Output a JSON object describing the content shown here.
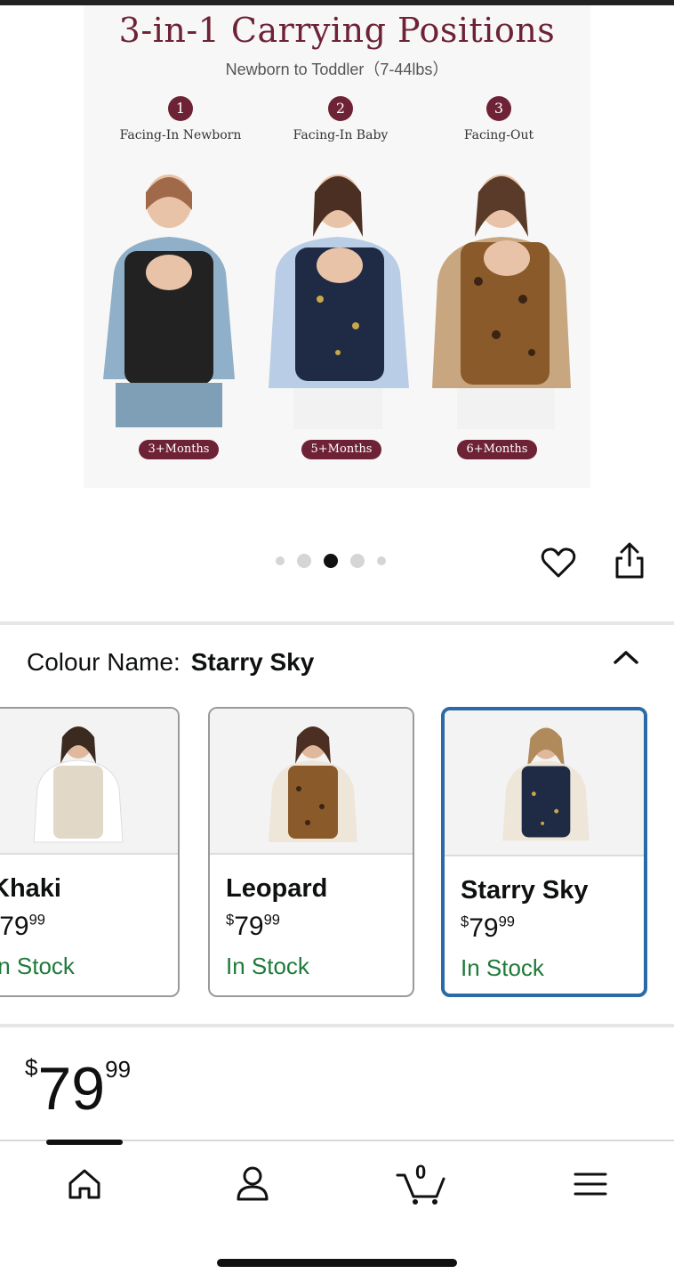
{
  "hero": {
    "title": "3-in-1 Carrying Positions",
    "subtitle": "Newborn to Toddler（7-44lbs）",
    "positions": [
      {
        "num": "1",
        "label": "Facing-In Newborn",
        "badge": "3+Months",
        "carrier_color": "#222222"
      },
      {
        "num": "2",
        "label": "Facing-In Baby",
        "badge": "5+Months",
        "carrier_color": "#1f2a44"
      },
      {
        "num": "3",
        "label": "Facing-Out",
        "badge": "6+Months",
        "carrier_color": "#8a5a2b"
      }
    ],
    "accent_color": "#6e2236"
  },
  "carousel": {
    "dot_count": 5,
    "active_index": 2
  },
  "actions": {
    "favorite_icon": "heart-icon",
    "share_icon": "share-icon"
  },
  "colour": {
    "label": "Colour Name:",
    "value": "Starry Sky",
    "toggle_icon": "chevron-up-icon"
  },
  "swatches": [
    {
      "name": "Khaki",
      "price_symbol": "$",
      "price_whole": "79",
      "price_fraction": "99",
      "stock": "In Stock",
      "carrier_color": "#e2d8c8",
      "selected": false
    },
    {
      "name": "Leopard",
      "price_symbol": "$",
      "price_whole": "79",
      "price_fraction": "99",
      "stock": "In Stock",
      "carrier_color": "#8a5a2b",
      "selected": false
    },
    {
      "name": "Starry Sky",
      "price_symbol": "$",
      "price_whole": "79",
      "price_fraction": "99",
      "stock": "In Stock",
      "carrier_color": "#1f2a44",
      "selected": true
    }
  ],
  "price": {
    "symbol": "$",
    "whole": "79",
    "fraction": "99"
  },
  "bottom_nav": {
    "items": [
      {
        "name": "home-icon"
      },
      {
        "name": "account-icon"
      },
      {
        "name": "cart-icon",
        "count": "0"
      },
      {
        "name": "menu-icon"
      }
    ]
  },
  "colors": {
    "stock_green": "#1f7a3a",
    "selected_border": "#2a6aa6"
  }
}
